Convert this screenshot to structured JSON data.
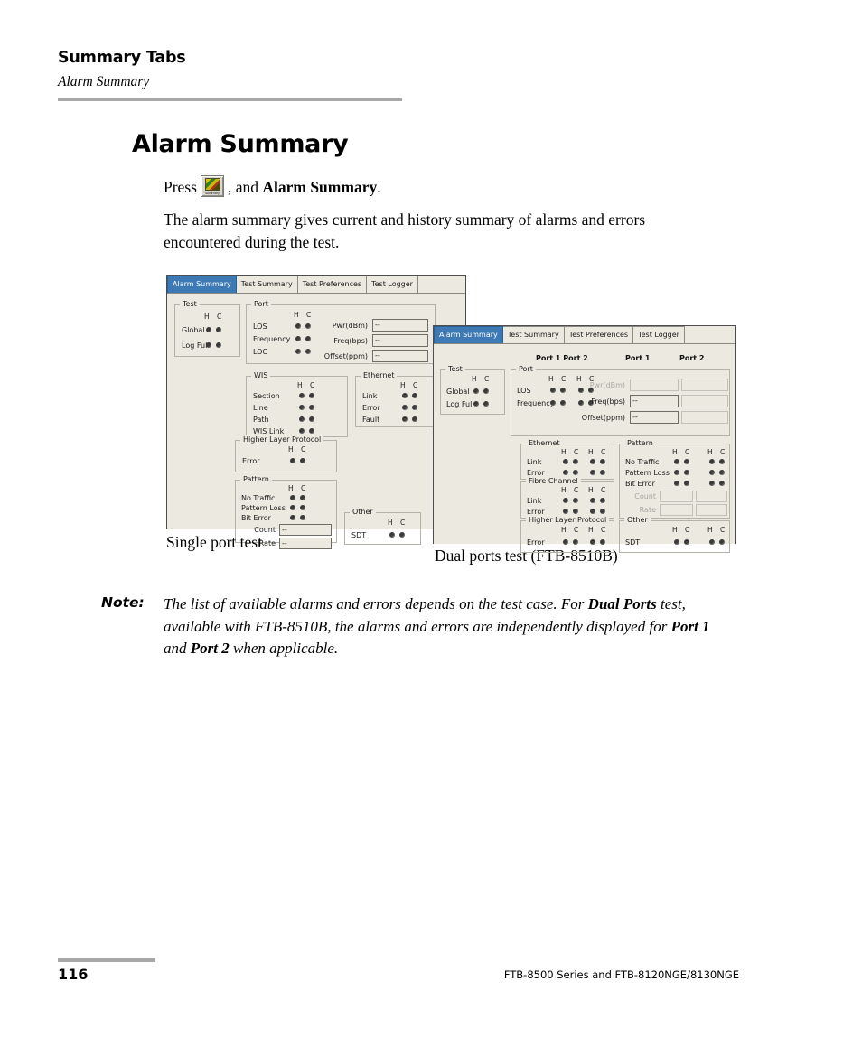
{
  "running_head": {
    "title": "Summary Tabs",
    "subtitle": "Alarm Summary"
  },
  "heading": "Alarm Summary",
  "paragraphs": {
    "press_prefix": "Press",
    "press_mid": ", and",
    "press_bold": "Alarm Summary",
    "press_suffix": ".",
    "description": "The alarm summary gives current and history summary of alarms and errors encountered during the test.",
    "toolbar_button_caption": "Summary"
  },
  "screenshot_single": {
    "caption": "Single port test",
    "tabs": [
      {
        "label": "Alarm Summary",
        "active": true
      },
      {
        "label": "Test Summary",
        "active": false
      },
      {
        "label": "Test Preferences",
        "active": false
      },
      {
        "label": "Test Logger",
        "active": false
      }
    ],
    "groups": {
      "test": {
        "legend": "Test",
        "hc": "H  C",
        "rows": [
          "Global",
          "Log Full"
        ]
      },
      "port": {
        "legend": "Port",
        "hc": "H  C",
        "rows": [
          "LOS",
          "Frequency",
          "LOC"
        ],
        "fields": [
          {
            "label": "Pwr(dBm)",
            "value": "--"
          },
          {
            "label": "Freq(bps)",
            "value": "--"
          },
          {
            "label": "Offset(ppm)",
            "value": "--"
          }
        ]
      },
      "wis": {
        "legend": "WIS",
        "hc": "H  C",
        "rows": [
          "Section",
          "Line",
          "Path",
          "WIS Link"
        ]
      },
      "ethernet": {
        "legend": "Ethernet",
        "hc": "H  C",
        "rows": [
          "Link",
          "Error",
          "Fault"
        ]
      },
      "higher_layer": {
        "legend": "Higher Layer Protocol",
        "hc": "H  C",
        "rows": [
          "Error"
        ]
      },
      "pattern": {
        "legend": "Pattern",
        "hc": "H  C",
        "rows": [
          "No Traffic",
          "Pattern Loss",
          "Bit Error"
        ],
        "fields": [
          {
            "label": "Count",
            "value": "--"
          },
          {
            "label": "Rate",
            "value": "--"
          }
        ]
      },
      "other": {
        "legend": "Other",
        "hc": "H  C",
        "rows": [
          "SDT"
        ]
      }
    }
  },
  "screenshot_dual": {
    "caption": "Dual ports test (FTB-8510B)",
    "tabs": [
      {
        "label": "Alarm Summary",
        "active": true
      },
      {
        "label": "Test Summary",
        "active": false
      },
      {
        "label": "Test Preferences",
        "active": false
      },
      {
        "label": "Test Logger",
        "active": false
      }
    ],
    "column_headers": {
      "leds": "Port 1 Port 2",
      "port1": "Port 1",
      "port2": "Port 2"
    },
    "groups": {
      "test": {
        "legend": "Test",
        "hc": "H  C",
        "rows": [
          "Global",
          "Log Full"
        ]
      },
      "port": {
        "legend": "Port",
        "hc": "H  C",
        "rows": [
          "LOS",
          "Frequency"
        ],
        "fields": [
          {
            "label": "Pwr(dBm)",
            "value_p1": "",
            "value_p2": "",
            "disabled": true
          },
          {
            "label": "Freq(bps)",
            "value_p1": "--",
            "value_p2": "",
            "disabled": false
          },
          {
            "label": "Offset(ppm)",
            "value_p1": "--",
            "value_p2": "",
            "disabled": false
          }
        ]
      },
      "ethernet": {
        "legend": "Ethernet",
        "hc": "H  C",
        "rows": [
          "Link",
          "Error"
        ]
      },
      "fibre_channel": {
        "legend": "Fibre Channel",
        "hc": "H  C",
        "rows": [
          "Link",
          "Error"
        ]
      },
      "higher_layer": {
        "legend": "Higher Layer Protocol",
        "hc": "H  C",
        "rows": [
          "Error"
        ]
      },
      "pattern": {
        "legend": "Pattern",
        "hc": "H  C",
        "rows": [
          "No Traffic",
          "Pattern Loss",
          "Bit Error"
        ],
        "fields": [
          {
            "label": "Count",
            "value_p1": "",
            "value_p2": "",
            "disabled": true
          },
          {
            "label": "Rate",
            "value_p1": "",
            "value_p2": "",
            "disabled": true
          }
        ]
      },
      "other": {
        "legend": "Other",
        "hc": "H  C",
        "rows": [
          "SDT"
        ]
      }
    }
  },
  "note": {
    "label": "Note:",
    "t1": "The list of available alarms and errors depends on the test case. For ",
    "b1": "Dual Ports",
    "t2": " test, available with FTB-8510B, the alarms and errors are independently displayed for ",
    "b2": "Port 1",
    "t3": " and ",
    "b3": "Port 2",
    "t4": " when applicable."
  },
  "footer": {
    "page_number": "116",
    "product_line": "FTB-8500 Series and FTB-8120NGE/8130NGE"
  },
  "colors": {
    "active_tab": "#3d7ab5",
    "panel_bg": "#ece9e0",
    "rule": "#a8a8a8"
  }
}
